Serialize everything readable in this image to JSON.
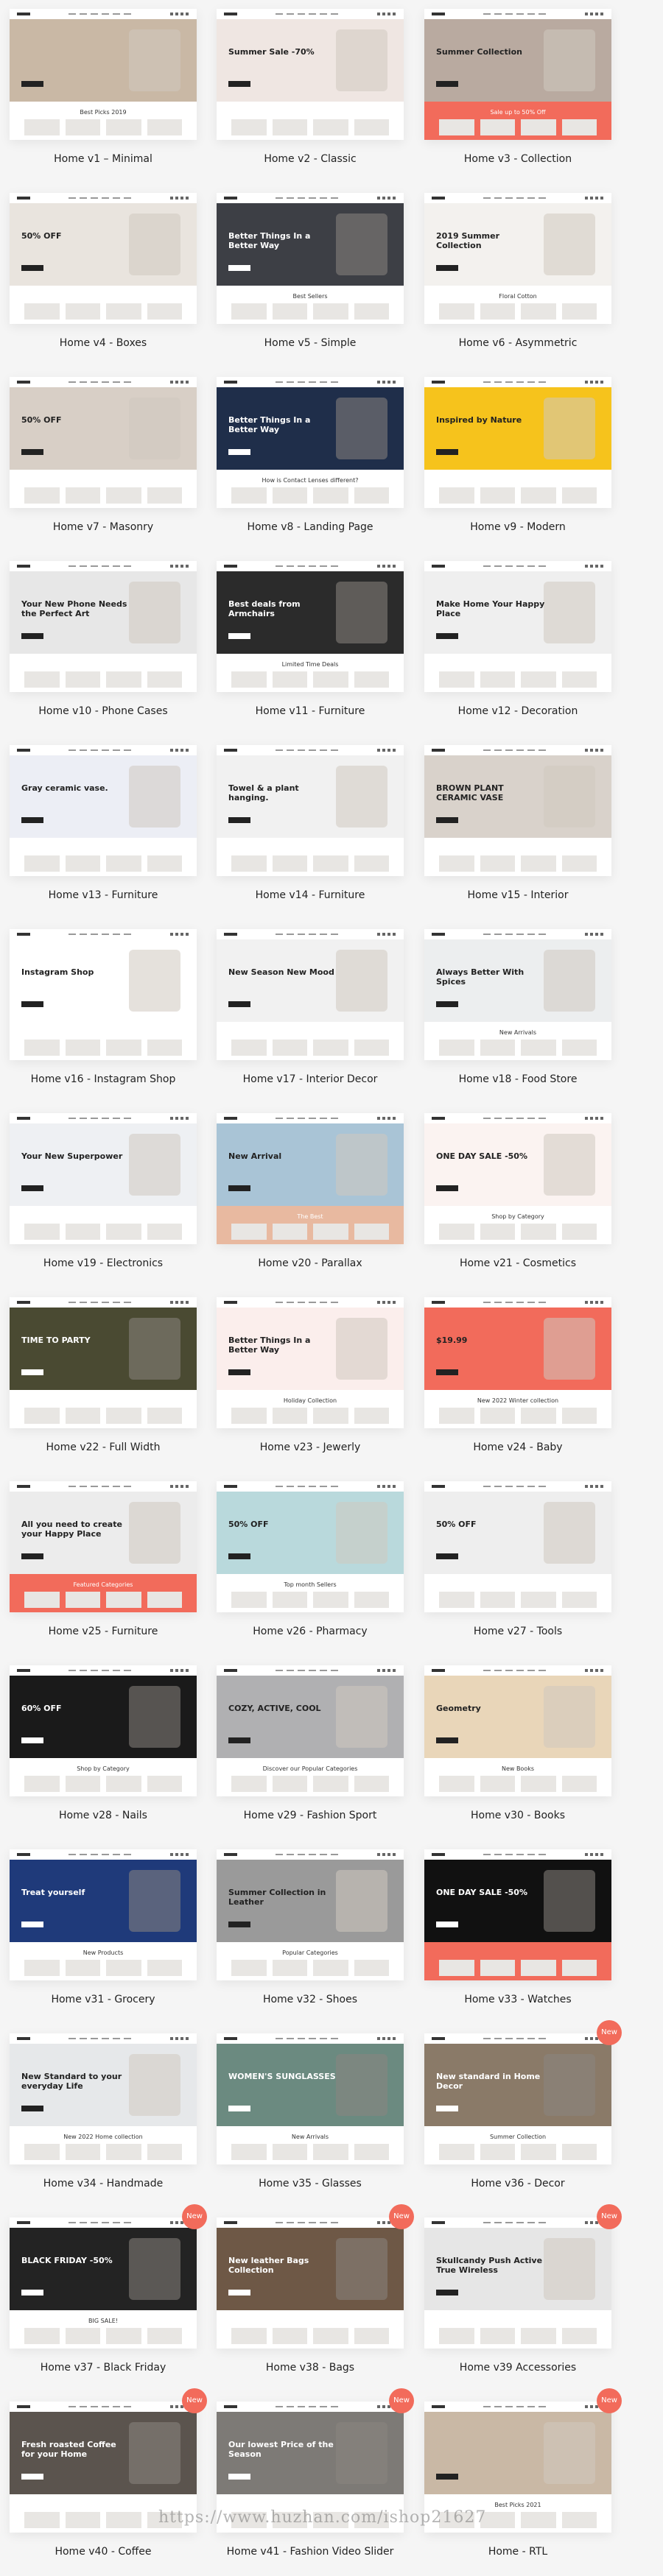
{
  "accent_color": "#f26b5b",
  "new_badge_label": "New",
  "watermark": "https://www.huzhan.com/ishop21627",
  "items": [
    {
      "caption": "Home v1 – Minimal",
      "hero": "",
      "sub": "Best Picks 2019",
      "bg": "#c9b8a5",
      "new": false
    },
    {
      "caption": "Home v2 - Classic",
      "hero": "Summer Sale -70%",
      "sub": "",
      "bg": "#efe6e2",
      "new": false
    },
    {
      "caption": "Home v3 - Collection",
      "hero": "Summer Collection",
      "sub": "Sale up to 50% Off",
      "bg": "#b9aaa0",
      "band": "#f26b5b",
      "new": false
    },
    {
      "caption": "Home v4 - Boxes",
      "hero": "50% OFF",
      "sub": "",
      "bg": "#e9e4de",
      "new": false
    },
    {
      "caption": "Home v5 - Simple",
      "hero": "Better Things In a Better Way",
      "sub": "Best Sellers",
      "bg": "#3d3f45",
      "new": false
    },
    {
      "caption": "Home v6 - Asymmetric",
      "hero": "2019 Summer Collection",
      "sub": "Floral Cotton",
      "bg": "#f3f1ee",
      "new": false
    },
    {
      "caption": "Home v7 - Masonry",
      "hero": "50% OFF",
      "sub": "",
      "bg": "#d8cfc6",
      "new": false
    },
    {
      "caption": "Home v8 - Landing Page",
      "hero": "Better Things In a Better Way",
      "sub": "How is Contact Lenses different?",
      "bg": "#1f2e4a",
      "new": false
    },
    {
      "caption": "Home v9 - Modern",
      "hero": "Inspired by Nature",
      "sub": "",
      "bg": "#f6c31c",
      "new": false
    },
    {
      "caption": "Home v10 - Phone Cases",
      "hero": "Your New Phone Needs the Perfect Art",
      "sub": "",
      "bg": "#e7e7e7",
      "new": false
    },
    {
      "caption": "Home v11 - Furniture",
      "hero": "Best deals from Armchairs",
      "sub": "Limited Time Deals",
      "bg": "#2b2b2b",
      "new": false
    },
    {
      "caption": "Home v12 - Decoration",
      "hero": "Make Home Your Happy Place",
      "sub": "",
      "bg": "#efefef",
      "new": false
    },
    {
      "caption": "Home v13 - Furniture",
      "hero": "Gray ceramic vase.",
      "sub": "",
      "bg": "#eceef5",
      "new": false
    },
    {
      "caption": "Home v14 - Furniture",
      "hero": "Towel & a plant hanging.",
      "sub": "",
      "bg": "#f1f1f1",
      "new": false
    },
    {
      "caption": "Home v15 - Interior",
      "hero": "BROWN PLANT CERAMIC VASE",
      "sub": "",
      "bg": "#d9d2cb",
      "new": false
    },
    {
      "caption": "Home v16 - Instagram Shop",
      "hero": "Instagram Shop",
      "sub": "",
      "bg": "#ffffff",
      "new": false
    },
    {
      "caption": "Home v17 - Interior Decor",
      "hero": "New Season New Mood",
      "sub": "",
      "bg": "#f1f1f1",
      "new": false
    },
    {
      "caption": "Home v18 - Food Store",
      "hero": "Always Better With Spices",
      "sub": "New Arrivals",
      "bg": "#eceeef",
      "new": false
    },
    {
      "caption": "Home v19 - Electronics",
      "hero": "Your New Superpower",
      "sub": "",
      "bg": "#eef0f3",
      "new": false
    },
    {
      "caption": "Home v20 - Parallax",
      "hero": "New Arrival",
      "sub": "The Best",
      "bg": "#a9c4d6",
      "band": "#e8b9a0",
      "new": false
    },
    {
      "caption": "Home v21 - Cosmetics",
      "hero": "ONE DAY SALE -50%",
      "sub": "Shop by Category",
      "bg": "#fbf3f1",
      "new": false
    },
    {
      "caption": "Home v22 - Full Width",
      "hero": "TIME TO PARTY",
      "sub": "",
      "bg": "#4a4a32",
      "new": false
    },
    {
      "caption": "Home v23 - Jewerly",
      "hero": "Better Things In a Better Way",
      "sub": "Holiday Collection",
      "bg": "#fbeeec",
      "new": false
    },
    {
      "caption": "Home v24 - Baby",
      "hero": "$19.99",
      "sub": "New 2022 Winter collection",
      "bg": "#f26b5b",
      "new": false
    },
    {
      "caption": "Home v25 - Furniture",
      "hero": "All you need to create your Happy Place",
      "sub": "Featured Categories",
      "bg": "#ececec",
      "band": "#f26b5b",
      "new": false
    },
    {
      "caption": "Home v26 - Pharmacy",
      "hero": "50% OFF",
      "sub": "Top month Sellers",
      "bg": "#b9d9dc",
      "new": false
    },
    {
      "caption": "Home v27 - Tools",
      "hero": "50% OFF",
      "sub": "",
      "bg": "#eeeeee",
      "new": false
    },
    {
      "caption": "Home v28 - Nails",
      "hero": "60% OFF",
      "sub": "Shop by Category",
      "bg": "#1a1a1a",
      "new": false
    },
    {
      "caption": "Home v29 - Fashion Sport",
      "hero": "COZY, ACTIVE, COOL",
      "sub": "Discover our Popular Categories",
      "bg": "#b0b0b2",
      "new": false
    },
    {
      "caption": "Home v30 - Books",
      "hero": "Geometry",
      "sub": "New Books",
      "bg": "#e9d6b9",
      "new": false
    },
    {
      "caption": "Home v31 - Grocery",
      "hero": "Treat yourself",
      "sub": "New Products",
      "bg": "#1f3a7a",
      "new": false
    },
    {
      "caption": "Home v32 - Shoes",
      "hero": "Summer Collection in Leather",
      "sub": "Popular Categories",
      "bg": "#9a9a9a",
      "new": false
    },
    {
      "caption": "Home v33 - Watches",
      "hero": "ONE DAY SALE -50%",
      "sub": "",
      "bg": "#111111",
      "band": "#f26b5b",
      "new": false
    },
    {
      "caption": "Home v34 - Handmade",
      "hero": "New Standard to your everyday Life",
      "sub": "New 2022 Home collection",
      "bg": "#e6e8ea",
      "new": false
    },
    {
      "caption": "Home v35 - Glasses",
      "hero": "WOMEN'S SUNGLASSES",
      "sub": "New Arrivals",
      "bg": "#6b8a80",
      "new": false
    },
    {
      "caption": "Home v36 - Decor",
      "hero": "New standard in Home Decor",
      "sub": "Summer Collection",
      "bg": "#8a7a68",
      "new": true
    },
    {
      "caption": "Home v37 - Black Friday",
      "hero": "BLACK FRIDAY -50%",
      "sub": "BIG SALE!",
      "bg": "#232323",
      "new": true
    },
    {
      "caption": "Home v38 - Bags",
      "hero": "New leather Bags Collection",
      "sub": "",
      "bg": "#6e5846",
      "new": true
    },
    {
      "caption": "Home v39 Accessories",
      "hero": "Skullcandy Push Active True Wireless",
      "sub": "",
      "bg": "#e6e6e6",
      "new": true
    },
    {
      "caption": "Home v40 - Coffee",
      "hero": "Fresh roasted Coffee for your Home",
      "sub": "",
      "bg": "#5b544e",
      "new": true
    },
    {
      "caption": "Home v41 - Fashion Video Slider",
      "hero": "Our lowest Price of the Season",
      "sub": "",
      "bg": "#7d7a76",
      "new": true
    },
    {
      "caption": "Home - RTL",
      "hero": "",
      "sub": "Best Picks 2021",
      "bg": "#c9b8a5",
      "new": true
    }
  ]
}
